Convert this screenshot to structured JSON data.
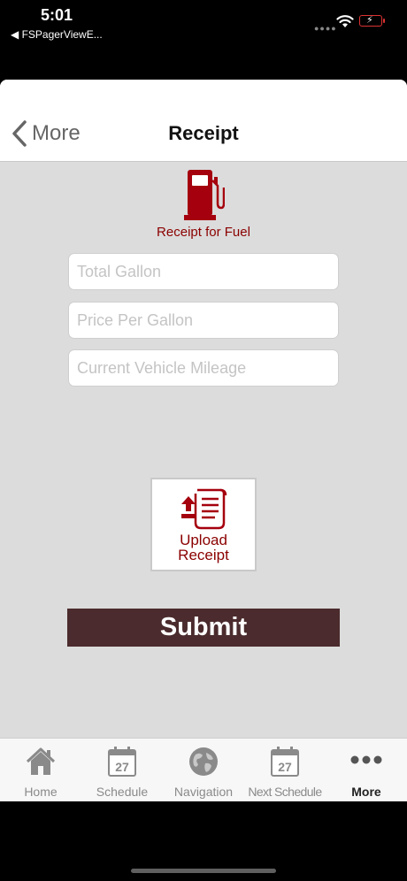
{
  "status_bar": {
    "time": "5:01",
    "back_app": "◀ FSPagerViewE..."
  },
  "nav": {
    "back_label": "More",
    "title": "Receipt"
  },
  "receipt": {
    "caption": "Receipt for Fuel",
    "fields": {
      "total_gallon": {
        "placeholder": "Total Gallon",
        "value": ""
      },
      "price_per_gallon": {
        "placeholder": "Price Per Gallon",
        "value": ""
      },
      "vehicle_mileage": {
        "placeholder": "Current Vehicle Mileage",
        "value": ""
      }
    },
    "upload_label": "Upload\nReceipt",
    "submit_label": "Submit"
  },
  "tabs": [
    {
      "label": "Home",
      "icon": "home-icon"
    },
    {
      "label": "Schedule",
      "icon": "calendar-icon",
      "day": "27"
    },
    {
      "label": "Navigation",
      "icon": "globe-icon"
    },
    {
      "label": "Next Schedule",
      "icon": "calendar-icon",
      "day": "27"
    },
    {
      "label": "More",
      "icon": "more-icon",
      "active": true
    }
  ],
  "colors": {
    "accent": "#8b0000",
    "submit_bg": "#4b2b2d",
    "content_bg": "#dcdcdc",
    "tab_inactive": "#8a8a8a"
  }
}
